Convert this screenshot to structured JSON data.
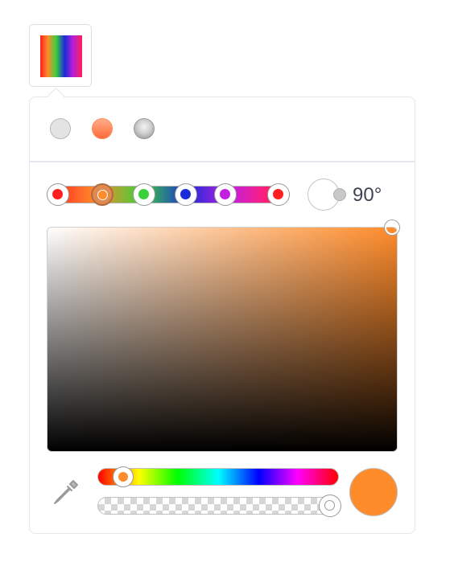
{
  "trigger": {
    "icon": "gradient-swatch"
  },
  "modes": [
    {
      "name": "solid",
      "active": false
    },
    {
      "name": "linear-gradient",
      "active": true
    },
    {
      "name": "radial-gradient",
      "active": false
    }
  ],
  "gradient": {
    "stops": [
      {
        "color": "#ff1f1f",
        "position": 0.0,
        "active": false
      },
      {
        "color": "#ff8c2a",
        "position": 0.2,
        "active": true
      },
      {
        "color": "#3ad03a",
        "position": 0.39,
        "active": false
      },
      {
        "color": "#1a2bd8",
        "position": 0.58,
        "active": false
      },
      {
        "color": "#c21fe0",
        "position": 0.76,
        "active": false
      },
      {
        "color": "#ff1f1f",
        "position": 1.0,
        "active": false
      }
    ],
    "angle_label": "90°"
  },
  "picker": {
    "hue_color": "#ff8c2a",
    "hue_fraction": 0.08,
    "alpha_fraction": 1.0,
    "preview_color": "#ff8c2a"
  },
  "icons": {
    "eyedropper": "eyedropper-icon"
  }
}
